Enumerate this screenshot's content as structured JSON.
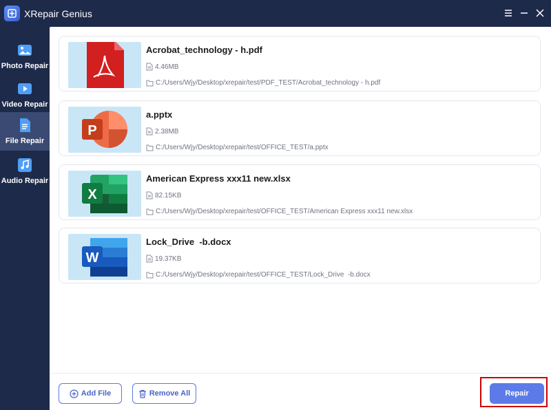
{
  "app": {
    "title": "XRepair Genius"
  },
  "window_controls": [
    "menu-icon",
    "minimize-icon",
    "close-icon"
  ],
  "sidebar": {
    "items": [
      {
        "label": "Photo Repair",
        "icon": "photo-icon",
        "active": false
      },
      {
        "label": "Video Repair",
        "icon": "video-icon",
        "active": false
      },
      {
        "label": "File Repair",
        "icon": "file-icon",
        "active": true
      },
      {
        "label": "Audio Repair",
        "icon": "music-icon",
        "active": false
      }
    ]
  },
  "files": [
    {
      "name": "Acrobat_technology - h.pdf",
      "size": "4.46MB",
      "path": "C:/Users/Wjy/Desktop/xrepair/test/PDF_TEST/Acrobat_technology - h.pdf",
      "type": "pdf"
    },
    {
      "name": "a.pptx",
      "size": "2.38MB",
      "path": "C:/Users/Wjy/Desktop/xrepair/test/OFFICE_TEST/a.pptx",
      "type": "pptx"
    },
    {
      "name": "American Express xxx11 new.xlsx",
      "size": "82.15KB",
      "path": "C:/Users/Wjy/Desktop/xrepair/test/OFFICE_TEST/American Express xxx11 new.xlsx",
      "type": "xlsx"
    },
    {
      "name": "Lock_Drive  -b.docx",
      "size": "19.37KB",
      "path": "C:/Users/Wjy/Desktop/xrepair/test/OFFICE_TEST/Lock_Drive  -b.docx",
      "type": "docx"
    }
  ],
  "footer": {
    "add_file_label": "Add File",
    "remove_all_label": "Remove All",
    "repair_label": "Repair"
  },
  "colors": {
    "sidebar_bg": "#1e2a4a",
    "active_item_bg": "#3a4a72",
    "accent": "#5d7be8",
    "highlight_border": "#cc0000"
  }
}
